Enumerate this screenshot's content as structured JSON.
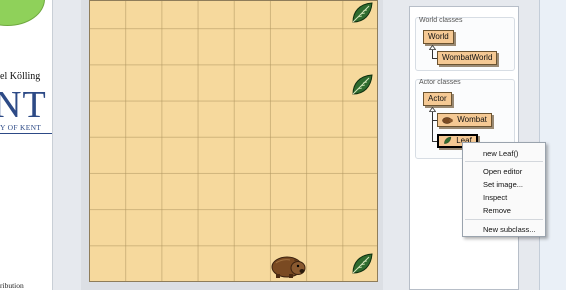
{
  "background_document": {
    "author_fragment": "el Kölling",
    "logo_fragment": "NT",
    "university_fragment": "Y OF KENT",
    "footer_fragment": "ribution"
  },
  "class_browser": {
    "world_section_title": "World classes",
    "world_classes": [
      "World",
      "WombatWorld"
    ],
    "actor_section_title": "Actor classes",
    "actor_classes": [
      "Actor",
      "Wombat",
      "Leaf"
    ]
  },
  "context_menu": {
    "items": [
      "new Leaf()",
      "Open editor",
      "Set image...",
      "Inspect",
      "Remove",
      "New subclass..."
    ]
  },
  "colors": {
    "world_background": "#f6d99d",
    "class_box": "#f5c994",
    "leaf_green": "#3a7d3a",
    "wombat_brown": "#7a4a22"
  },
  "icons": [
    "leaf-icon",
    "wombat-icon"
  ]
}
